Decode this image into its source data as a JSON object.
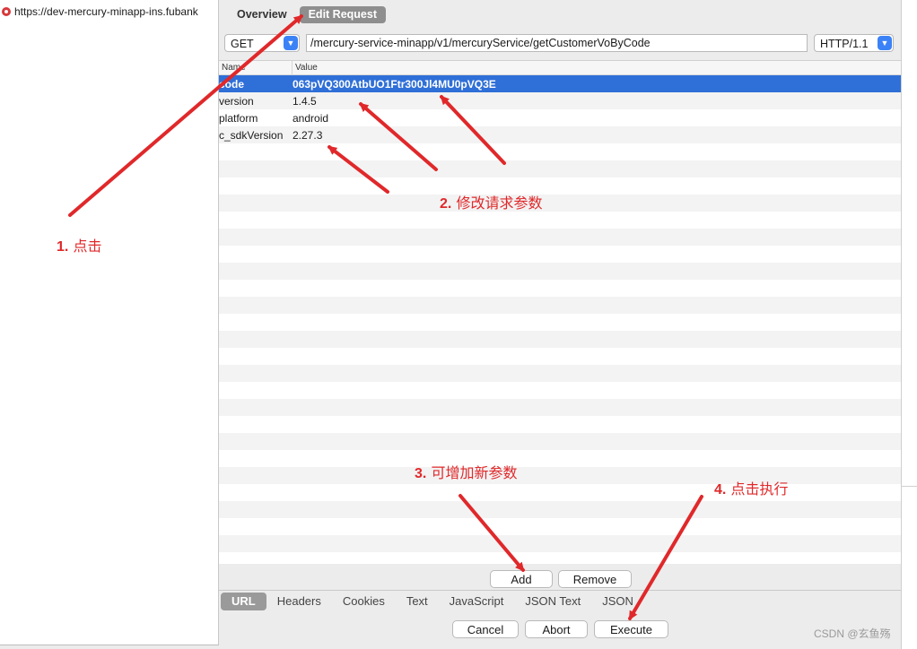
{
  "sidebar": {
    "url_text": "https://dev-mercury-minapp-ins.fubank"
  },
  "top_tabs": [
    {
      "label": "Overview",
      "active": false
    },
    {
      "label": "Edit Request",
      "active": true
    }
  ],
  "request": {
    "method": "GET",
    "path": "/mercury-service-minapp/v1/mercuryService/getCustomerVoByCode",
    "protocol": "HTTP/1.1"
  },
  "params_table": {
    "columns": [
      "Name",
      "Value"
    ],
    "rows": [
      {
        "name": "code",
        "value": "063pVQ300AtbUO1Ftr300Jl4MU0pVQ3E",
        "selected": true
      },
      {
        "name": "version",
        "value": "1.4.5",
        "selected": false
      },
      {
        "name": "platform",
        "value": "android",
        "selected": false
      },
      {
        "name": "c_sdkVersion",
        "value": "2.27.3",
        "selected": false
      }
    ]
  },
  "table_buttons": {
    "add": "Add",
    "remove": "Remove"
  },
  "bottom_tabs": [
    {
      "label": "URL",
      "active": true
    },
    {
      "label": "Headers",
      "active": false
    },
    {
      "label": "Cookies",
      "active": false
    },
    {
      "label": "Text",
      "active": false
    },
    {
      "label": "JavaScript",
      "active": false
    },
    {
      "label": "JSON Text",
      "active": false
    },
    {
      "label": "JSON",
      "active": false
    }
  ],
  "action_buttons": {
    "cancel": "Cancel",
    "abort": "Abort",
    "execute": "Execute"
  },
  "annotations": {
    "step1_num": "1.",
    "step1_text": "点击",
    "step2_num": "2.",
    "step2_text": "修改请求参数",
    "step3_num": "3.",
    "step3_text": "可增加新参数",
    "step4_num": "4.",
    "step4_text": "点击执行"
  },
  "watermark": "CSDN @玄鱼殇",
  "colors": {
    "annotation_red": "#e0282a",
    "selected_row": "#2f6fd8",
    "select_chevron": "#3b82f6"
  }
}
